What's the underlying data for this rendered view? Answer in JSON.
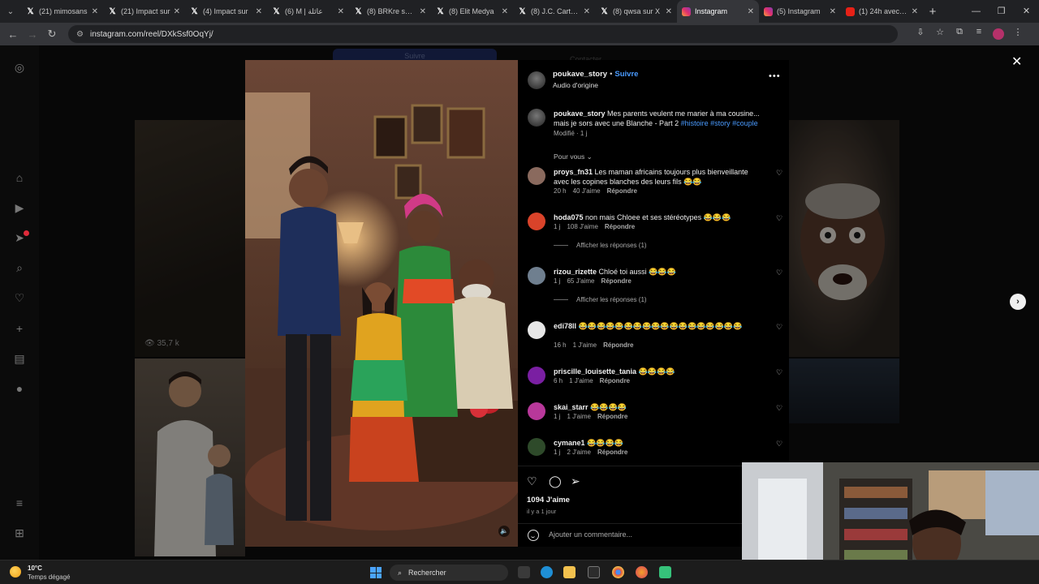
{
  "browser": {
    "tabs": [
      {
        "title": "(21) mimosans",
        "icon": "x-icon"
      },
      {
        "title": "(21) Impact sur",
        "icon": "x-icon"
      },
      {
        "title": "(4) Impact sur",
        "icon": "x-icon"
      },
      {
        "title": "(6) M | عائلة",
        "icon": "x-icon"
      },
      {
        "title": "(8) BRKre sur X",
        "icon": "x-icon"
      },
      {
        "title": "(8) Elit Medya",
        "icon": "x-icon"
      },
      {
        "title": "(8) J.C. Carter s",
        "icon": "x-icon"
      },
      {
        "title": "(8) qwsa sur X",
        "icon": "x-icon"
      },
      {
        "title": "Instagram",
        "icon": "instagram-icon",
        "active": true
      },
      {
        "title": "(5) Instagram",
        "icon": "instagram-icon"
      },
      {
        "title": "(1) 24h avec La",
        "icon": "youtube-icon"
      }
    ],
    "url": "instagram.com/reel/DXkSsf0OqYj/"
  },
  "page": {
    "background_ghost": {
      "button": "Suivre",
      "label": "Contacter"
    },
    "views_count": "35,7 k"
  },
  "post": {
    "author": "poukave_story",
    "follow_label": "Suivre",
    "separator": "•",
    "audio": "Audio d'origine",
    "caption_user": "poukave_story",
    "caption_text": "Mes parents veulent me marier à ma cousine... mais je sors avec une Blanche - Part 2",
    "caption_tags": "#histoire #story #couple",
    "caption_meta": "Modifié · 1 j",
    "sort_label": "Pour vous",
    "comments": [
      {
        "user": "proys_fn31",
        "text": "Les maman africains toujours plus bienveillante avec les copines blanches des leurs fils 😂😂",
        "time": "20 h",
        "likes": "40 J'aime",
        "reply": "Répondre",
        "avatar_color": "#8a6a5e"
      },
      {
        "user": "hoda075",
        "text": "non mais Chloee et ses stéréotypes 😂😂😂",
        "time": "1 j",
        "likes": "108 J'aime",
        "reply": "Répondre",
        "avatar_color": "#d9432a",
        "replies": "Afficher les réponses (1)"
      },
      {
        "user": "rizou_rizette",
        "text": "Chloé toi aussi 😂😂😂",
        "time": "1 j",
        "likes": "65 J'aime",
        "reply": "Répondre",
        "avatar_color": "#6f7f8f",
        "replies": "Afficher les réponses (1)"
      },
      {
        "user": "edi78ll",
        "text": "😂😂😂😂😂😂😂😂😂😂😂😂😂😂😂😂😂😂",
        "time": "16 h",
        "likes": "1 J'aime",
        "reply": "Répondre",
        "avatar_color": "#e6e6e6"
      },
      {
        "user": "priscille_louisette_tania",
        "text": "😂😂😂😂",
        "time": "6 h",
        "likes": "1 J'aime",
        "reply": "Répondre",
        "avatar_color": "#7a1fa2"
      },
      {
        "user": "skai_starr",
        "text": "😂😂😂😂",
        "time": "1 j",
        "likes": "1 J'aime",
        "reply": "Répondre",
        "avatar_color": "#b8389a"
      },
      {
        "user": "cymane1",
        "text": "😂😂😂😂",
        "time": "1 j",
        "likes": "2 J'aime",
        "reply": "Répondre",
        "avatar_color": "#2e4a2a"
      }
    ],
    "likes_count": "1094 J'aime",
    "posted": "il y a 1 jour",
    "comment_placeholder": "Ajouter un commentaire..."
  },
  "taskbar": {
    "temperature": "10°C",
    "weather": "Temps dégagé",
    "search_label": "Rechercher"
  }
}
